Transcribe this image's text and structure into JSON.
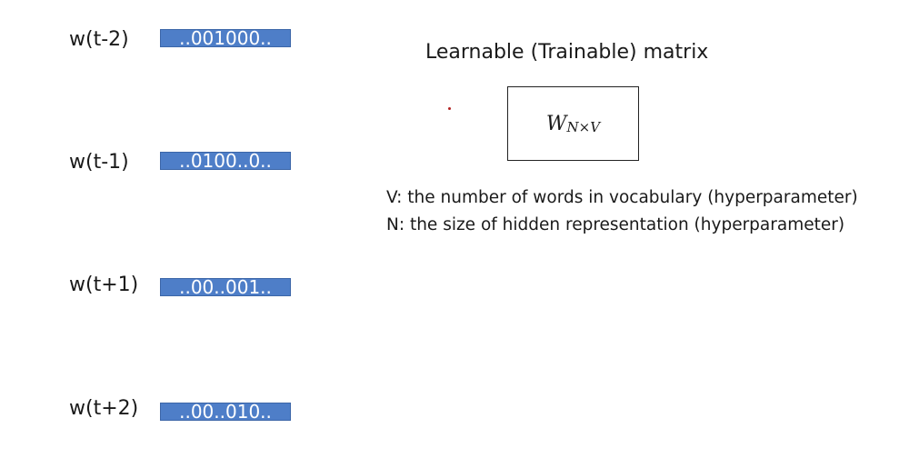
{
  "context_words": [
    {
      "label": "w(t-2)",
      "vector": "..001000.."
    },
    {
      "label": "w(t-1)",
      "vector": "..0100..0.."
    },
    {
      "label": "w(t+1)",
      "vector": "..00..001.."
    },
    {
      "label": "w(t+2)",
      "vector": "..00..010.."
    }
  ],
  "matrix": {
    "title": "Learnable (Trainable) matrix",
    "symbol": "W",
    "subscript": "N×V"
  },
  "definitions": {
    "v": "V: the number of words in vocabulary  (hyperparameter)",
    "n": "N: the size of hidden representation (hyperparameter)"
  },
  "colors": {
    "vector_fill": "#4e7ec8",
    "vector_text": "#ffffff",
    "marker_dot": "#b22222"
  }
}
